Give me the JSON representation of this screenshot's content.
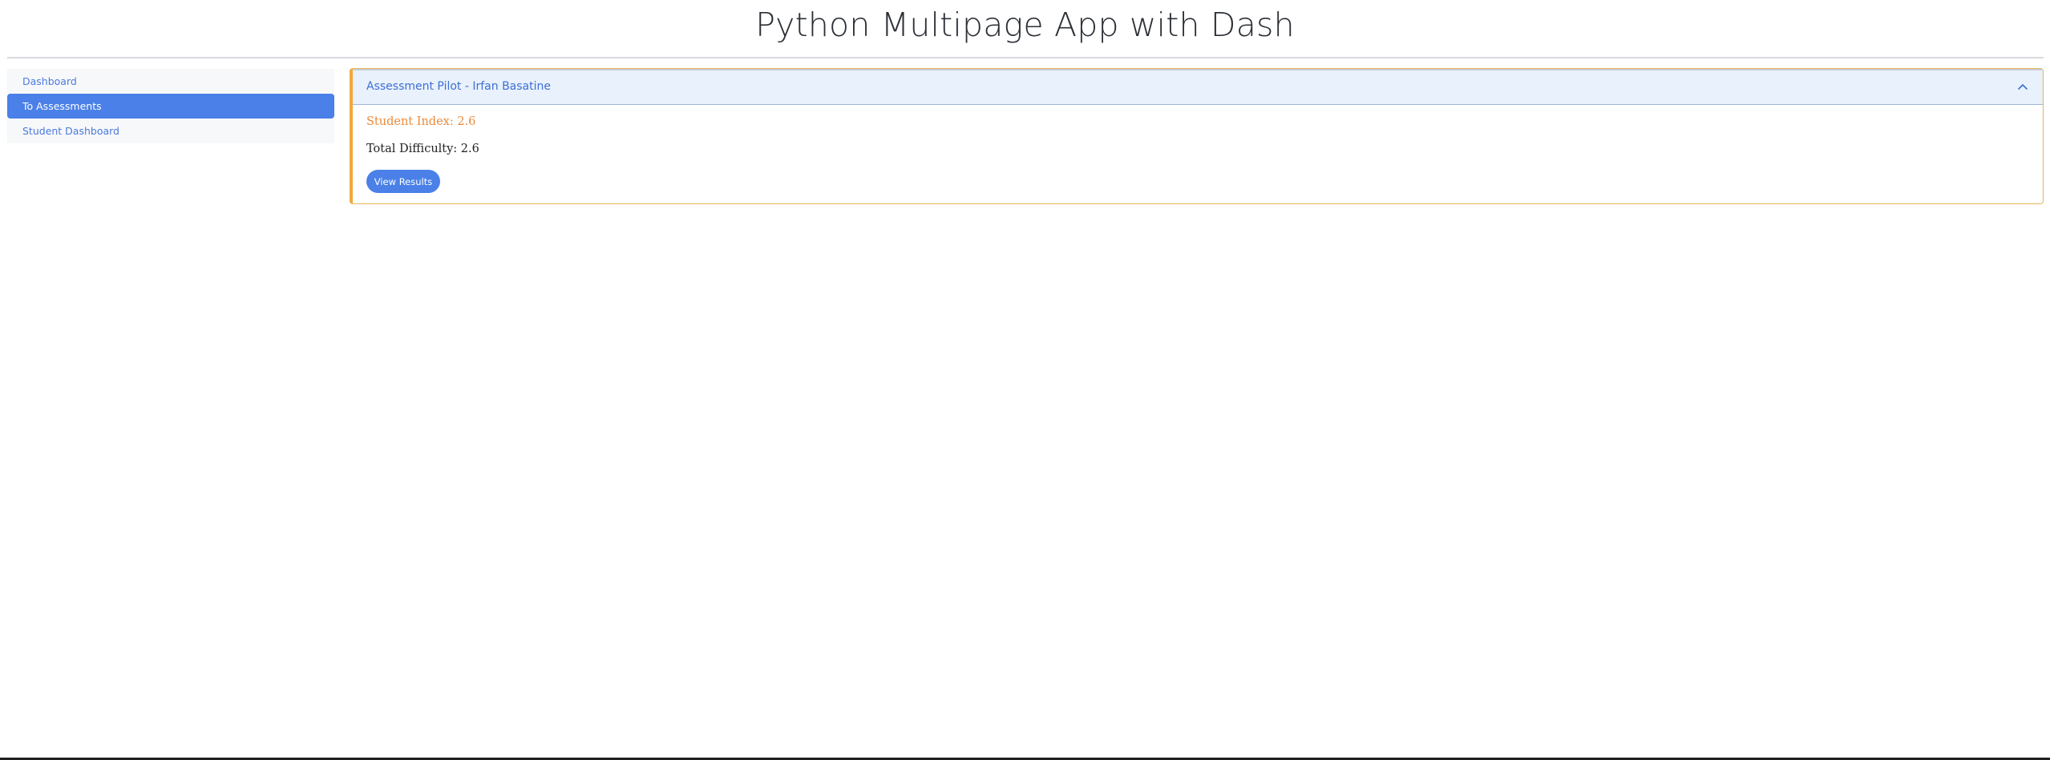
{
  "header": {
    "title": "Python Multipage App with Dash"
  },
  "sidebar": {
    "items": [
      {
        "label": "Dashboard",
        "active": false
      },
      {
        "label": "To Assessments",
        "active": true
      },
      {
        "label": "Student Dashboard",
        "active": false
      }
    ]
  },
  "assessment": {
    "title": "Assessment Pilot - Irfan Basatine",
    "expanded": true,
    "student_index_text": "Student Index: 2.6",
    "total_difficulty_text": "Total Difficulty: 2.6",
    "view_button_label": "View Results"
  },
  "colors": {
    "accent": "#4a80e8",
    "link": "#4a7ae0",
    "warning": "#f0a93c",
    "header_bg": "#e9f1fc"
  },
  "icons": {
    "collapse": "chevron-up-icon"
  }
}
